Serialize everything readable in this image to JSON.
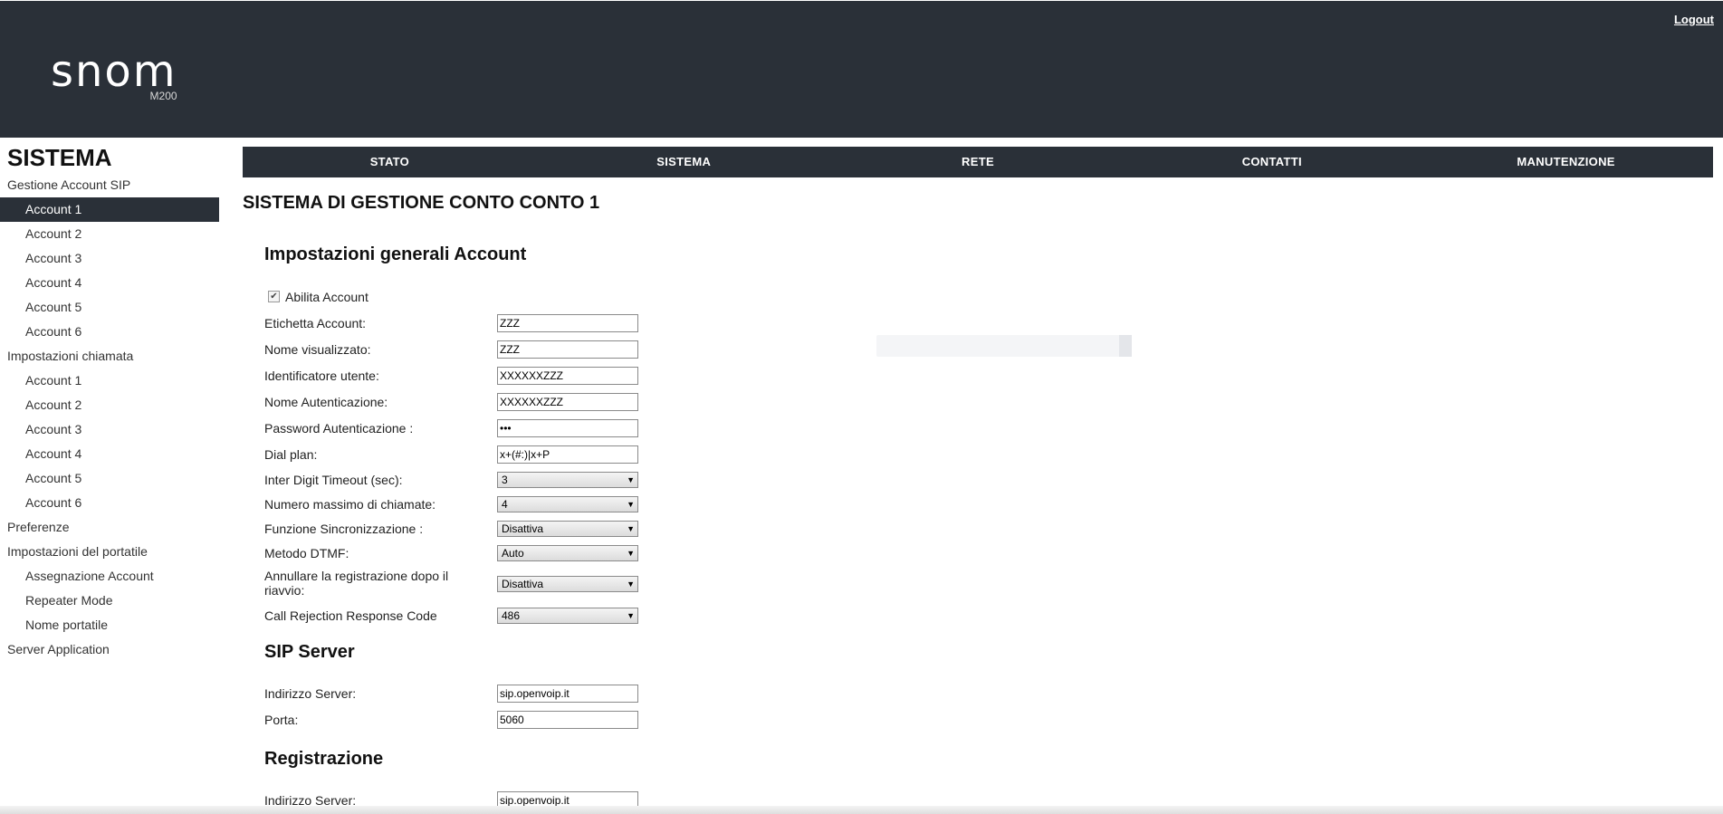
{
  "header": {
    "logo_text": "snom",
    "model": "M200",
    "logout_label": "Logout"
  },
  "sidebar": {
    "title": "SISTEMA",
    "items": [
      {
        "label": "Gestione Account SIP",
        "level": 0,
        "active": false
      },
      {
        "label": "Account 1",
        "level": 1,
        "active": true
      },
      {
        "label": "Account 2",
        "level": 1,
        "active": false
      },
      {
        "label": "Account 3",
        "level": 1,
        "active": false
      },
      {
        "label": "Account 4",
        "level": 1,
        "active": false
      },
      {
        "label": "Account 5",
        "level": 1,
        "active": false
      },
      {
        "label": "Account 6",
        "level": 1,
        "active": false
      },
      {
        "label": "Impostazioni chiamata",
        "level": 0,
        "active": false
      },
      {
        "label": "Account 1",
        "level": 1,
        "active": false
      },
      {
        "label": "Account 2",
        "level": 1,
        "active": false
      },
      {
        "label": "Account 3",
        "level": 1,
        "active": false
      },
      {
        "label": "Account 4",
        "level": 1,
        "active": false
      },
      {
        "label": "Account 5",
        "level": 1,
        "active": false
      },
      {
        "label": "Account 6",
        "level": 1,
        "active": false
      },
      {
        "label": "Preferenze",
        "level": 0,
        "active": false
      },
      {
        "label": "Impostazioni del portatile",
        "level": 0,
        "active": false
      },
      {
        "label": "Assegnazione Account",
        "level": 1,
        "active": false
      },
      {
        "label": "Repeater Mode",
        "level": 1,
        "active": false
      },
      {
        "label": "Nome portatile",
        "level": 1,
        "active": false
      },
      {
        "label": "Server Application",
        "level": 0,
        "active": false
      }
    ]
  },
  "nav": {
    "items": [
      "STATO",
      "SISTEMA",
      "RETE",
      "CONTATTI",
      "MANUTENZIONE"
    ]
  },
  "main": {
    "page_title": "SISTEMA DI GESTIONE CONTO CONTO 1",
    "general": {
      "title": "Impostazioni generali Account",
      "enable_label": "Abilita Account",
      "enable_checked": true,
      "account_label": {
        "label": "Etichetta Account:",
        "value": "ZZZ"
      },
      "display_name": {
        "label": "Nome visualizzato:",
        "value": "ZZZ"
      },
      "user_id": {
        "label": "Identificatore utente:",
        "value": "XXXXXXZZZ"
      },
      "auth_name": {
        "label": "Nome Autenticazione:",
        "value": "XXXXXXZZZ"
      },
      "auth_password": {
        "label": "Password Autenticazione :",
        "value": "•••"
      },
      "dial_plan": {
        "label": "Dial plan:",
        "value": "x+(#:)|x+P"
      },
      "inter_digit": {
        "label": "Inter Digit Timeout (sec):",
        "value": "3"
      },
      "max_calls": {
        "label": "Numero massimo di chiamate:",
        "value": "4"
      },
      "sync": {
        "label": "Funzione Sincronizzazione :",
        "value": "Disattiva"
      },
      "dtmf": {
        "label": "Metodo DTMF:",
        "value": "Auto"
      },
      "unregister": {
        "label": "Annullare la registrazione dopo il riavvio:",
        "value": "Disattiva"
      },
      "reject_code": {
        "label": "Call Rejection Response Code",
        "value": "486"
      }
    },
    "sip_server": {
      "title": "SIP Server",
      "address": {
        "label": "Indirizzo Server:",
        "value": "sip.openvoip.it"
      },
      "port": {
        "label": "Porta:",
        "value": "5060"
      }
    },
    "registration": {
      "title": "Registrazione",
      "address": {
        "label": "Indirizzo Server:",
        "value": "sip.openvoip.it"
      }
    }
  },
  "colors": {
    "header_bg": "#2a3038",
    "active_item_bg": "#2a3038"
  }
}
